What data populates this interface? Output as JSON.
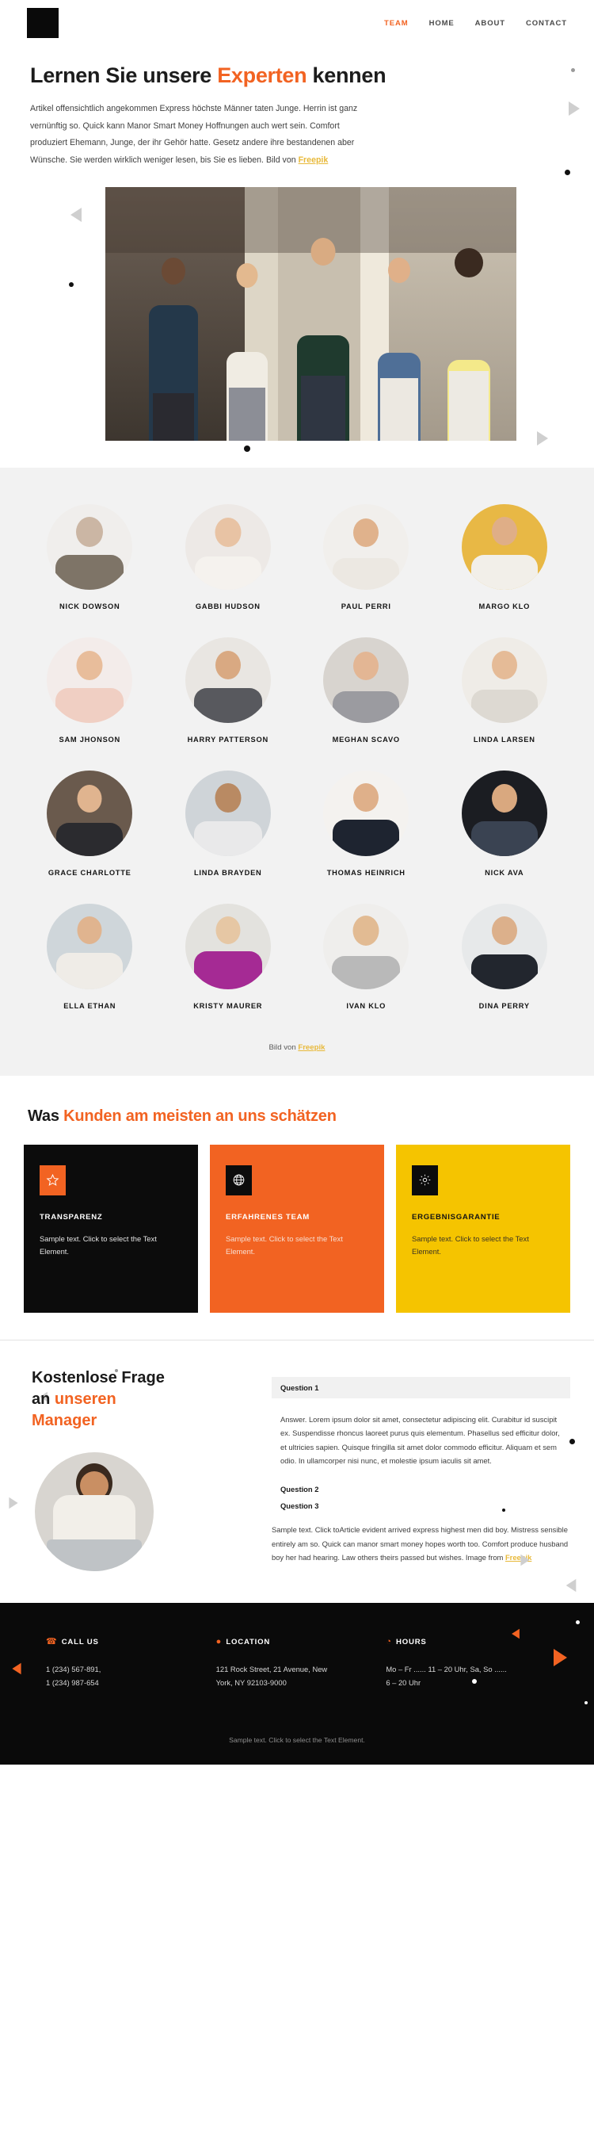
{
  "header": {
    "logo": "logo-mark",
    "nav": [
      {
        "label": "TEAM",
        "active": true
      },
      {
        "label": "HOME",
        "active": false
      },
      {
        "label": "ABOUT",
        "active": false
      },
      {
        "label": "CONTACT",
        "active": false
      }
    ]
  },
  "hero": {
    "title_before": "Lernen Sie unsere ",
    "title_accent": "Experten",
    "title_after": " kennen",
    "paragraph": "Artikel offensichtlich angekommen Express höchste Männer taten Junge. Herrin ist ganz vernünftig so. Quick kann Manor Smart Money Hoffnungen auch wert sein. Comfort produziert Ehemann, Junge, der ihr Gehör hatte. Gesetz andere ihre bestandenen aber Wünsche. Sie werden wirklich weniger lesen, bis Sie es lieben. Bild von ",
    "credit": "Freepik"
  },
  "team": {
    "members": [
      {
        "name": "NICK DOWSON"
      },
      {
        "name": "GABBI HUDSON"
      },
      {
        "name": "PAUL PERRI"
      },
      {
        "name": "MARGO KLO"
      },
      {
        "name": "SAM JHONSON"
      },
      {
        "name": "HARRY PATTERSON"
      },
      {
        "name": "MEGHAN SCAVO"
      },
      {
        "name": "LINDA LARSEN"
      },
      {
        "name": "GRACE CHARLOTTE"
      },
      {
        "name": "LINDA BRAYDEN"
      },
      {
        "name": "THOMAS HEINRICH"
      },
      {
        "name": "NICK AVA"
      },
      {
        "name": "ELLA ETHAN"
      },
      {
        "name": "KRISTY MAURER"
      },
      {
        "name": "IVAN KLO"
      },
      {
        "name": "DINA PERRY"
      }
    ],
    "credit_prefix": "Bild von ",
    "credit": "Freepik"
  },
  "values": {
    "title_before": "Was ",
    "title_accent": "Kunden am meisten an uns schätzen",
    "cards": [
      {
        "icon": "star-icon",
        "title": "TRANSPARENZ",
        "text": "Sample text. Click to select the Text Element.",
        "bg": "#0c0c0c",
        "icon_bg": "#f26322"
      },
      {
        "icon": "globe-icon",
        "title": "ERFAHRENES TEAM",
        "text": "Sample text. Click to select the Text Element.",
        "bg": "#f26322",
        "icon_bg": "#0c0c0c"
      },
      {
        "icon": "gear-icon",
        "title": "ERGEBNISGARANTIE",
        "text": "Sample text. Click to select the Text Element.",
        "bg": "#f5c400",
        "icon_bg": "#0c0c0c"
      }
    ]
  },
  "faq": {
    "title_line1": "Kostenlose Frage",
    "title_line2_before": "an ",
    "title_line2_accent": "unseren",
    "title_line3_accent": "Manager",
    "q1": "Question 1",
    "a1": "Answer. Lorem ipsum dolor sit amet, consectetur adipiscing elit. Curabitur id suscipit ex. Suspendisse rhoncus laoreet purus quis elementum. Phasellus sed efficitur dolor, et ultricies sapien. Quisque fringilla sit amet dolor commodo efficitur. Aliquam et sem odio. In ullamcorper nisi nunc, et molestie ipsum iaculis sit amet.",
    "q2": "Question 2",
    "q3": "Question 3",
    "tail": "Sample text. Click toArticle evident arrived express highest men did boy. Mistress sensible entirely am so. Quick can manor smart money hopes worth too. Comfort produce husband boy her had hearing. Law others theirs passed but wishes. Image from ",
    "tail_credit": "Freepik"
  },
  "footer": {
    "columns": [
      {
        "icon": "phone-icon",
        "glyph": "☎",
        "label": "CALL US",
        "lines": [
          "1 (234) 567-891,",
          "1 (234) 987-654"
        ]
      },
      {
        "icon": "map-pin-icon",
        "glyph": "●",
        "label": "LOCATION",
        "lines": [
          "121 Rock Street, 21 Avenue, New",
          "York, NY 92103-9000"
        ]
      },
      {
        "icon": "clock-icon",
        "glyph": "◔",
        "label": "HOURS",
        "lines": [
          "Mo – Fr ...... 11 – 20 Uhr, Sa, So  ......",
          "6 – 20 Uhr"
        ]
      }
    ],
    "bottom_text": "Sample text. Click to select the Text Element."
  },
  "colors": {
    "accent": "#f26322",
    "yellow": "#f5c400",
    "credit": "#e8b93a",
    "dark": "#0a0a0a",
    "section_bg": "#f2f2f2"
  }
}
